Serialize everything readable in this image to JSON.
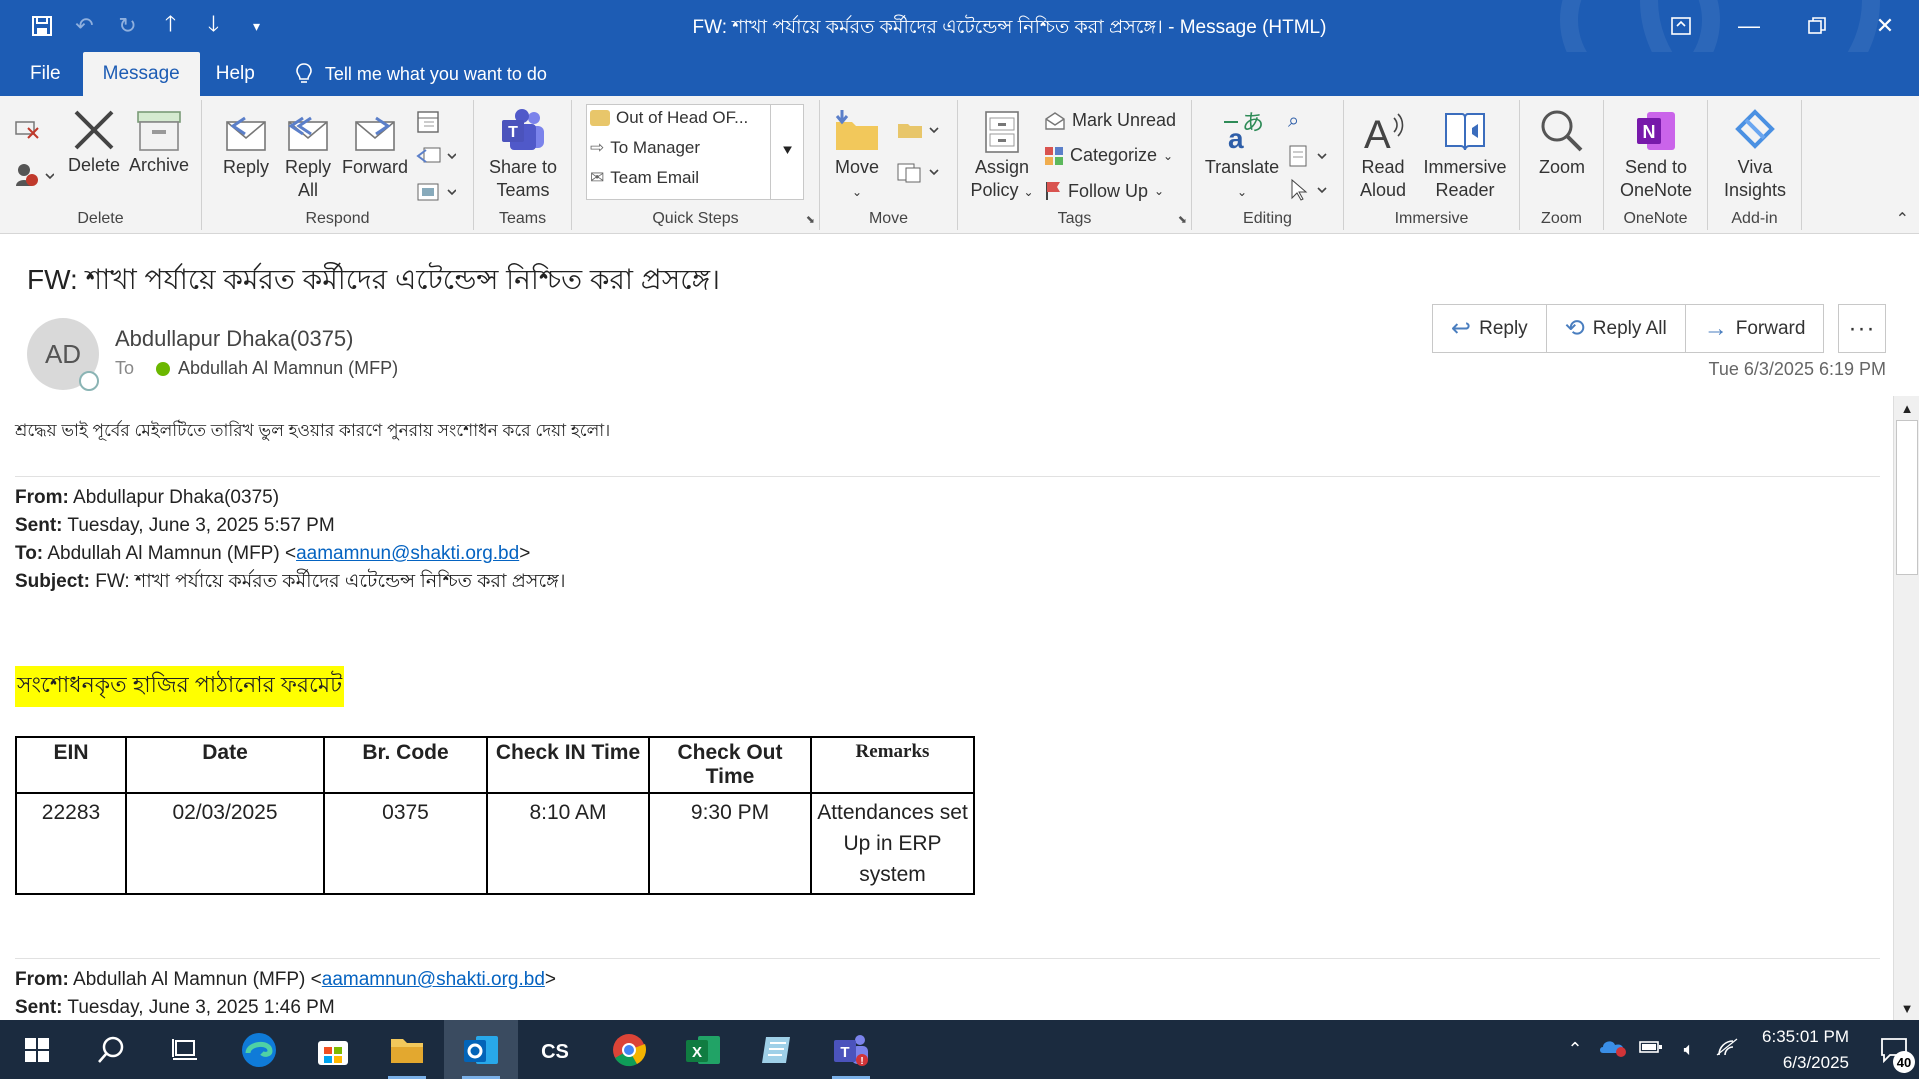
{
  "window": {
    "title": "FW: শাখা পর্যায়ে কর্মরত কর্মীদের এটেন্ডেন্স নিশ্চিত করা প্রসঙ্গে।  -  Message (HTML)"
  },
  "menu": {
    "tabs": [
      "File",
      "Message",
      "Help"
    ],
    "tell_me": "Tell me what you want to do"
  },
  "ribbon": {
    "delete_group": {
      "label": "Delete",
      "delete": "Delete",
      "archive": "Archive"
    },
    "respond_group": {
      "label": "Respond",
      "reply": "Reply",
      "reply_all_1": "Reply",
      "reply_all_2": "All",
      "forward": "Forward"
    },
    "teams_group": {
      "label": "Teams",
      "share_1": "Share to",
      "share_2": "Teams"
    },
    "quick_steps": {
      "label": "Quick Steps",
      "items": [
        "Out of Head OF...",
        "To Manager",
        "Team Email"
      ]
    },
    "move_group": {
      "label": "Move",
      "move": "Move"
    },
    "tags_group": {
      "label": "Tags",
      "assign_1": "Assign",
      "assign_2": "Policy",
      "mark_unread": "Mark Unread",
      "categorize": "Categorize",
      "follow_up": "Follow Up"
    },
    "editing_group": {
      "label": "Editing",
      "translate": "Translate"
    },
    "immersive_group": {
      "label": "Immersive",
      "read_1": "Read",
      "read_2": "Aloud",
      "reader_1": "Immersive",
      "reader_2": "Reader"
    },
    "zoom_group": {
      "label": "Zoom",
      "zoom": "Zoom"
    },
    "onenote_group": {
      "label": "OneNote",
      "send_1": "Send to",
      "send_2": "OneNote"
    },
    "addin_group": {
      "label": "Add-in",
      "viva_1": "Viva",
      "viva_2": "Insights"
    }
  },
  "message": {
    "subject": "FW: শাখা পর্যায়ে কর্মরত কর্মীদের এটেন্ডেন্স নিশ্চিত করা প্রসঙ্গে।",
    "avatar_initials": "AD",
    "sender": "Abdullapur Dhaka(0375)",
    "to_label": "To",
    "recipient": "Abdullah Al Mamnun (MFP)",
    "actions": {
      "reply": "Reply",
      "reply_all": "Reply All",
      "forward": "Forward",
      "more": "···"
    },
    "datetime": "Tue 6/3/2025 6:19 PM"
  },
  "body": {
    "intro": "শ্রদ্ধেয় ভাই পূর্বের মেইলটিতে তারিখ ভুল হওয়ার কারণে পুনরায় সংশোধন করে দেয়া হলো।",
    "fwd1": {
      "from_label": "From:",
      "from": " Abdullapur Dhaka(0375)",
      "sent_label": "Sent:",
      "sent": " Tuesday, June 3, 2025 5:57 PM",
      "to_label": "To:",
      "to": " Abdullah Al Mamnun (MFP) <",
      "to_email": "aamamnun@shakti.org.bd",
      "to_end": ">",
      "subject_label": "Subject:",
      "subject": " FW: শাখা পর্যায়ে কর্মরত কর্মীদের এটেন্ডেন্স নিশ্চিত করা প্রসঙ্গে।"
    },
    "highlight": "সংশোধনকৃত হাজির পাঠানোর ফরমেট",
    "table": {
      "headers": [
        "EIN",
        "Date",
        "Br. Code",
        "Check IN Time",
        "Check Out Time",
        "Remarks"
      ],
      "row": [
        "22283",
        "02/03/2025",
        "0375",
        "8:10 AM",
        "9:30 PM",
        "Attendances set Up in ERP system"
      ]
    },
    "fwd2": {
      "from_label": "From:",
      "from": " Abdullah Al Mamnun (MFP) <",
      "from_email": "aamamnun@shakti.org.bd",
      "from_end": ">",
      "sent_label": "Sent:",
      "sent": " Tuesday, June 3, 2025 1:46 PM"
    }
  },
  "taskbar": {
    "time": "6:35:01 PM",
    "date": "6/3/2025",
    "notifications": "40"
  }
}
